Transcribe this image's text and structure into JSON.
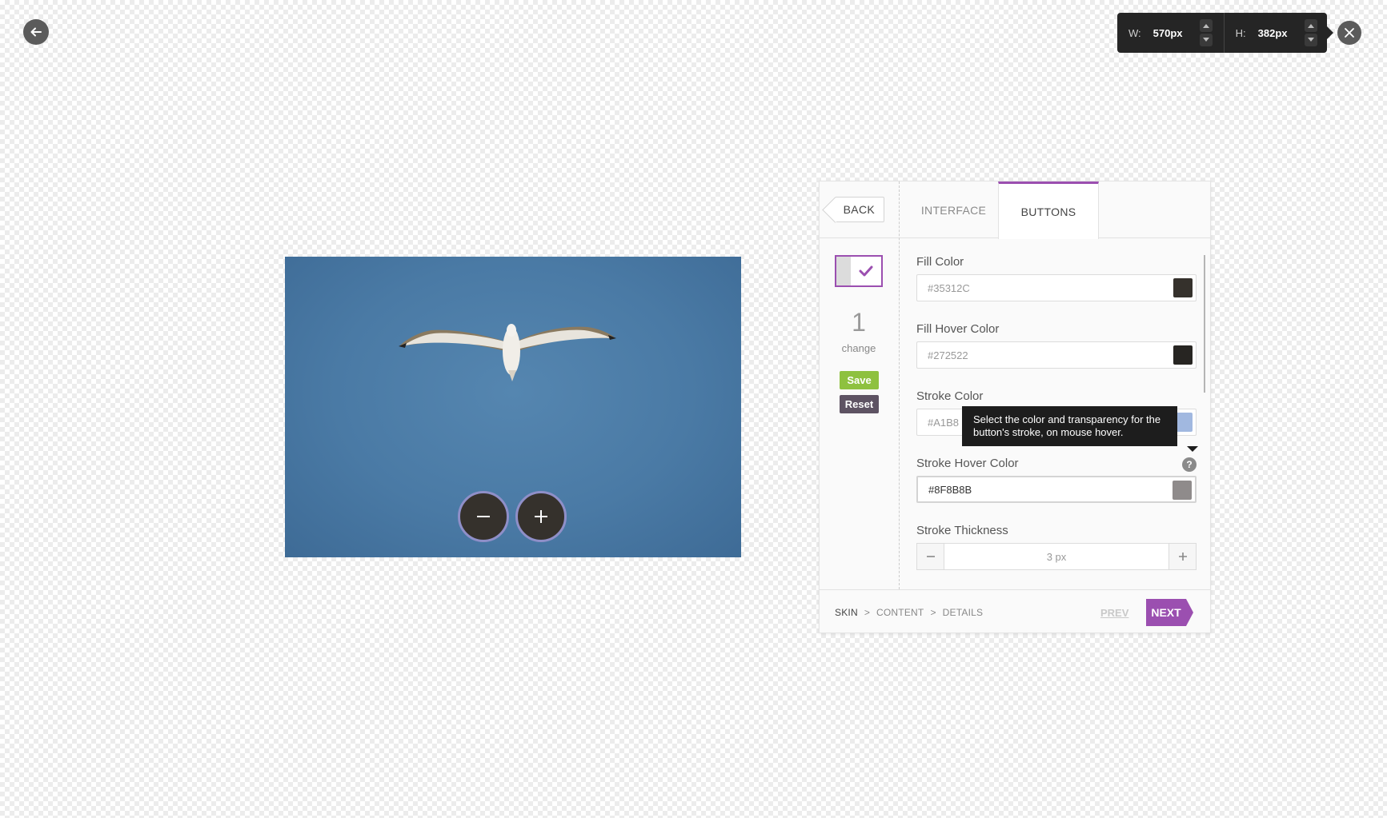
{
  "size": {
    "width_label": "W:",
    "width_value": "570px",
    "height_label": "H:",
    "height_value": "382px"
  },
  "panel": {
    "back_label": "BACK",
    "tabs": [
      {
        "label": "INTERFACE",
        "active": false
      },
      {
        "label": "BUTTONS",
        "active": true
      }
    ],
    "changes": {
      "count": "1",
      "label": "change",
      "save_label": "Save",
      "reset_label": "Reset"
    },
    "fields": {
      "fill_color": {
        "label": "Fill Color",
        "value": "#35312C",
        "color": "#35312C"
      },
      "fill_hover_color": {
        "label": "Fill Hover Color",
        "value": "#272522",
        "color": "#272522"
      },
      "stroke_color": {
        "label": "Stroke Color",
        "value": "#A1B8",
        "color": "#A1B8E0"
      },
      "stroke_hover_color": {
        "label": "Stroke Hover Color",
        "value": "#8F8B8B",
        "color": "#8F8B8B"
      },
      "stroke_thickness": {
        "label": "Stroke Thickness",
        "value": "3 px"
      }
    },
    "tooltip": "Select the color and transparency for the button's stroke, on mouse hover.",
    "help_glyph": "?",
    "footer": {
      "crumbs": [
        "SKIN",
        ">",
        "CONTENT",
        ">",
        "DETAILS"
      ],
      "prev_label": "PREV",
      "next_label": "NEXT"
    }
  },
  "colors": {
    "accent": "#9B4FB0",
    "save": "#8EC13F",
    "reset": "#5E5363",
    "zoom_button": "#35312C",
    "zoom_stroke": "#8F8FC8",
    "sky": "#4A7AA5"
  },
  "icons": {
    "back": "arrow-left-icon",
    "close": "close-icon",
    "zoom_out": "minus-icon",
    "zoom_in": "plus-icon"
  }
}
